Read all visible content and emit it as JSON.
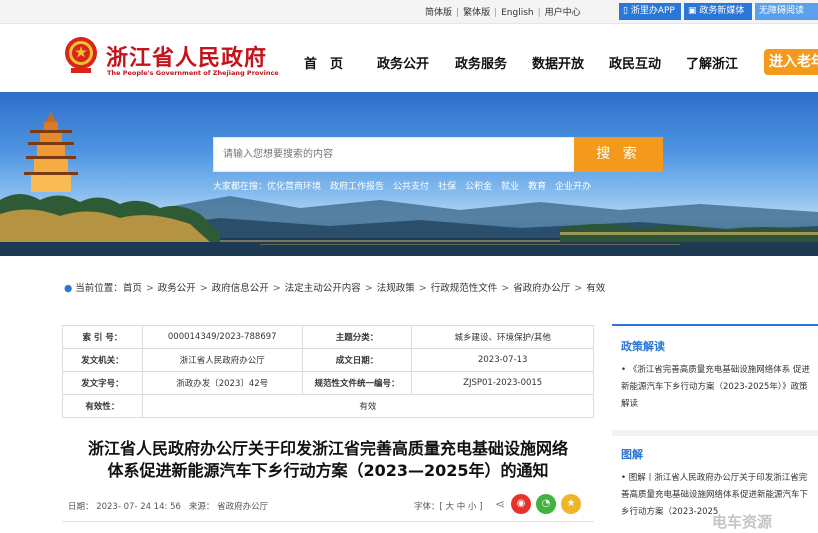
{
  "topbar": {
    "lang_simplified": "简体版",
    "lang_traditional": "繁体版",
    "lang_english": "English",
    "user_center": "用户中心",
    "app_button": "浙里办APP",
    "media_button": "政务新媒体",
    "access_button": "无障碍阅读"
  },
  "header": {
    "logo_cn": "浙江省人民政府",
    "logo_en": "The People's Government of Zhejiang Province",
    "nav": [
      "首　页",
      "政务公开",
      "政务服务",
      "数据开放",
      "政民互动",
      "了解浙江"
    ],
    "elder_button": "进入老年"
  },
  "banner": {
    "search_placeholder": "请输入您想要搜索的内容",
    "search_button": "搜 索",
    "hot_label": "大家都在搜：",
    "hot_terms": [
      "优化营商环境",
      "政府工作报告",
      "公共支付",
      "社保",
      "公积金",
      "就业",
      "教育",
      "企业开办"
    ]
  },
  "breadcrumb": {
    "label": "当前位置：",
    "items": [
      "首页",
      "政务公开",
      "政府信息公开",
      "法定主动公开内容",
      "法规政策",
      "行政规范性文件",
      "省政府办公厅",
      "有效"
    ]
  },
  "info_table": {
    "index_label": "索 引 号：",
    "index_value": "000014349/2023-788697",
    "topic_label": "主题分类：",
    "topic_value": "城乡建设、环境保护/其他",
    "org_label": "发文机关：",
    "org_value": "浙江省人民政府办公厅",
    "date_label": "成文日期：",
    "date_value": "2023-07-13",
    "num_label": "发文字号：",
    "num_value": "浙政办发〔2023〕42号",
    "code_label": "规范性文件统一编号：",
    "code_value": "ZJSP01-2023-0015",
    "valid_label": "有效性：",
    "valid_value": "有效"
  },
  "document": {
    "title_line1": "浙江省人民政府办公厅关于印发浙江省完善高质量充电基础设施网络",
    "title_line2": "体系促进新能源汽车下乡行动方案（2023—2025年）的通知",
    "date": "日期： 2023- 07- 24 14: 56",
    "source": "来源： 省政府办公厅",
    "font_size": "字体：[ 大 中 小 ]"
  },
  "sidebar": {
    "policy_heading": "政策解读",
    "policy_item": "《浙江省完善高质量充电基础设施网络体系 促进新能源汽车下乡行动方案（2023-2025年）》政策解读",
    "graphic_heading": "图解",
    "graphic_item": "图解丨浙江省人民政府办公厅关于印发浙江省完善高质量充电基础设施网络体系促进新能源汽车下乡行动方案（2023-2025"
  },
  "watermark": "电车资源",
  "colors": {
    "brand_red": "#c2141a",
    "accent_blue": "#2b77d8",
    "accent_orange": "#f39a1c"
  }
}
